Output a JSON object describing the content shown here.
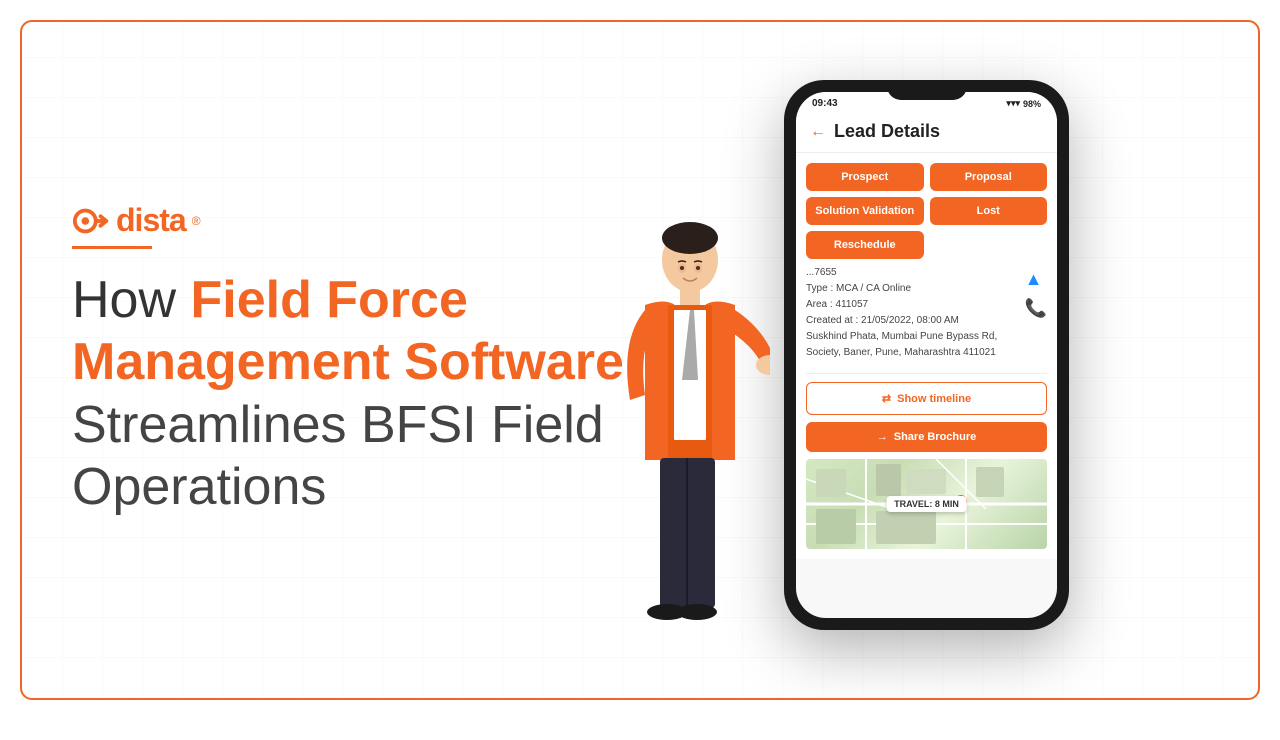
{
  "page": {
    "border_color": "#f26522",
    "bg_color": "#fff"
  },
  "logo": {
    "text": "dista",
    "reg_symbol": "®"
  },
  "headline": {
    "line1_normal": "How ",
    "line1_highlight": "Field Force",
    "line2_highlight": "Management Software",
    "line3_normal": "Streamlines BFSI Field",
    "line4_normal": "Operations"
  },
  "phone": {
    "status_bar": {
      "time": "09:43",
      "battery": "98%",
      "signal_icon": "wifi-signal-icon"
    },
    "header": {
      "back_icon": "←",
      "title": "Lead Details"
    },
    "status_buttons": [
      {
        "label": "Prospect",
        "full_width": false
      },
      {
        "label": "Proposal",
        "full_width": false
      },
      {
        "label": "Solution Validation",
        "full_width": false
      },
      {
        "label": "Lost",
        "full_width": false
      },
      {
        "label": "Reschedule",
        "full_width": false
      }
    ],
    "lead_info": {
      "id": "...7655",
      "type": "Type : MCA / CA Online",
      "area": "Area : 411057",
      "created": "Created at : 21/05/2022, 08:00 AM",
      "address": "Suskhind Phata, Mumbai Pune Bypass Rd,  Society, Baner, Pune, Maharashtra 411021"
    },
    "icons": {
      "location_icon": "▲",
      "phone_icon": "📞"
    },
    "timeline_btn": "Show timeline",
    "share_btn": "Share Brochure",
    "map": {
      "travel_badge": "TRAVEL: 8 MIN"
    }
  }
}
